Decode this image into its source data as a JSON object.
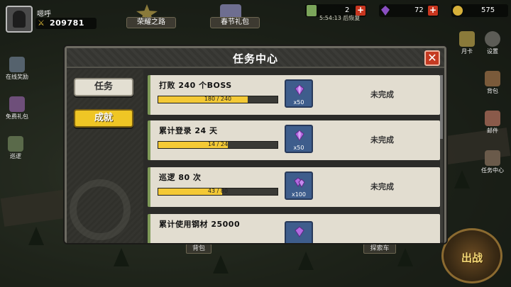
{
  "player": {
    "name": "嗯呼",
    "power": "209781",
    "power_icon": "crossed-swords-icon"
  },
  "top_buttons": [
    {
      "label": "荣耀之路",
      "icon": "star-badge-icon"
    },
    {
      "label": "春节礼包",
      "icon": "gift-box-icon"
    }
  ],
  "resources": {
    "energy": "2",
    "timer": "5:54:13",
    "timer_label": "后恢复",
    "gems": "72",
    "coins": "575"
  },
  "left_side": [
    "在线奖励",
    "免费礼包",
    "巡逻"
  ],
  "right_side": [
    "月卡",
    "设置",
    "背包",
    "邮件",
    "任务中心"
  ],
  "bottom_labels": [
    "背包",
    "探索车"
  ],
  "battle_label": "出战",
  "dialog": {
    "title": "任务中心",
    "close_icon": "close-x-icon",
    "tabs": [
      {
        "label": "任务",
        "active": false
      },
      {
        "label": "成就",
        "active": true
      }
    ],
    "tasks": [
      {
        "title": "打败 240 个BOSS",
        "progress": "180 / 240",
        "fill": 0.75,
        "reward_qty": "x50",
        "status": "未完成"
      },
      {
        "title": "累计登录 24 天",
        "progress": "14 / 24",
        "fill": 0.583,
        "reward_qty": "x50",
        "status": "未完成"
      },
      {
        "title": "巡逻 80 次",
        "progress": "43 / 80",
        "fill": 0.5375,
        "reward_qty": "x100",
        "status": "未完成"
      },
      {
        "title": "累计使用钢材 25000",
        "progress": "",
        "fill": 0,
        "reward_qty": "",
        "status": ""
      }
    ]
  },
  "colors": {
    "accent": "#efc625",
    "close": "#c53a22",
    "gem": "#b36ae0",
    "bar_fill": "#f4c935"
  }
}
